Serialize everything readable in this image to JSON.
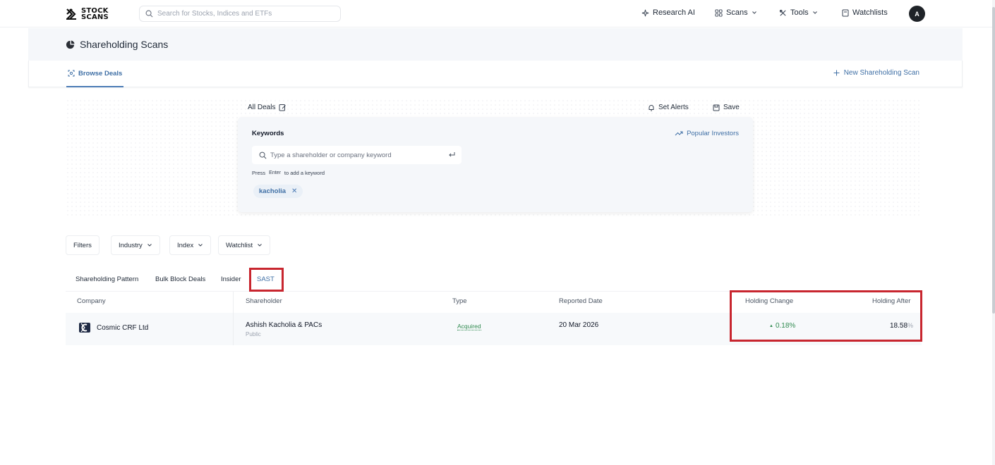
{
  "header": {
    "logo_line1": "STOCK",
    "logo_line2": "SCANS",
    "search_placeholder": "Search for Stocks, Indices and ETFs",
    "nav": {
      "research": "Research AI",
      "scans": "Scans",
      "tools": "Tools",
      "watchlists": "Watchlists"
    },
    "avatar_initial": "A"
  },
  "page": {
    "title": "Shareholding Scans",
    "browse_tab": "Browse Deals",
    "new_scan": "New Shareholding Scan"
  },
  "deals": {
    "label": "All Deals",
    "set_alerts": "Set Alerts",
    "save": "Save"
  },
  "keywords": {
    "title": "Keywords",
    "popular": "Popular Investors",
    "placeholder": "Type a shareholder or company keyword",
    "hint_press": "Press",
    "hint_key": "Enter",
    "hint_rest": "to add a keyword",
    "chips": [
      "kacholia"
    ]
  },
  "filters": {
    "filters": "Filters",
    "industry": "Industry",
    "index": "Index",
    "watchlist": "Watchlist"
  },
  "data_tabs": {
    "shareholding": "Shareholding Pattern",
    "bulk": "Bulk Block Deals",
    "insider": "Insider",
    "sast": "SAST",
    "active": "SAST"
  },
  "table": {
    "columns": {
      "company": "Company",
      "shareholder": "Shareholder",
      "type": "Type",
      "reported_date": "Reported Date",
      "holding_change": "Holding Change",
      "holding_after": "Holding After"
    },
    "rows": [
      {
        "company": "Cosmic CRF Ltd",
        "shareholder": "Ashish Kacholia & PACs",
        "shareholder_category": "Public",
        "type": "Acquired",
        "reported_date": "20 Mar 2026",
        "holding_change": "0.18%",
        "holding_after": "18.58",
        "holding_after_unit": "%"
      }
    ]
  },
  "colors": {
    "accent": "#3f6fa5",
    "positive": "#2f8a4f",
    "highlight": "#c8262f"
  }
}
